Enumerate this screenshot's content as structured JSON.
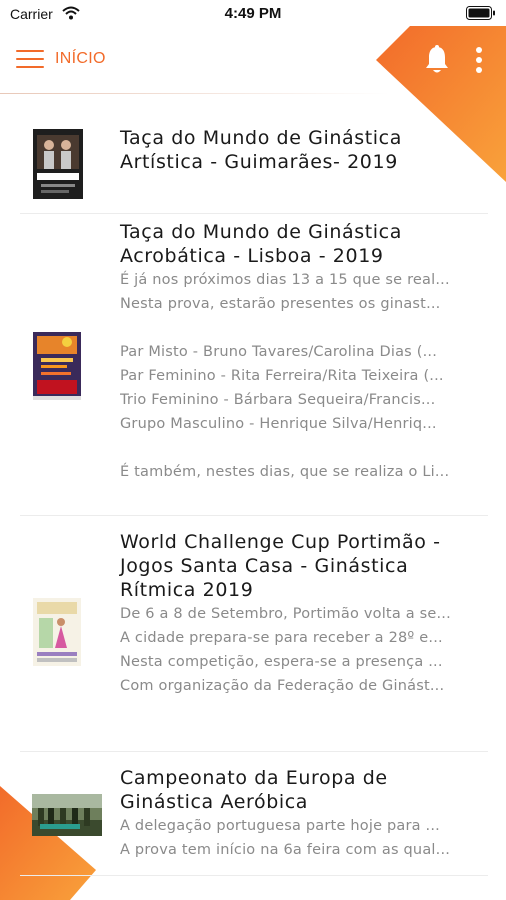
{
  "status_bar": {
    "carrier": "Carrier",
    "time": "4:49 PM"
  },
  "header": {
    "title": "INÍCIO"
  },
  "colors": {
    "accent": "#f26b2a",
    "accent_light": "#f9a23b"
  },
  "icons": {
    "menu": "hamburger-icon",
    "bell": "bell-icon",
    "more": "more-vertical-icon",
    "wifi": "wifi-icon",
    "battery": "battery-icon"
  },
  "news": [
    {
      "title": "Taça do Mundo de Ginástica Artística - Guimarães- 2019",
      "lines": []
    },
    {
      "title": "Taça do Mundo de Ginástica Acrobática - Lisboa - 2019",
      "lines": [
        "É já nos próximos dias 13 a 15 que se real...",
        "Nesta prova, estarão presentes os ginast...",
        "",
        "Par Misto - Bruno Tavares/Carolina Dias (...",
        "Par Feminino - Rita Ferreira/Rita Teixeira (...",
        "Trio Feminino - Bárbara Sequeira/Francis...",
        "Grupo Masculino - Henrique Silva/Henriq...",
        "",
        "É também, nestes dias, que se realiza o Li..."
      ]
    },
    {
      "title": "World Challenge Cup Portimão - Jogos Santa Casa - Ginástica Rítmica 2019",
      "lines": [
        "De 6 a 8 de Setembro, Portimão volta a se...",
        " A cidade prepara-se para receber a 28º e...",
        "Nesta competição, espera-se a presença ...",
        "Com organização da Federação de Ginást..."
      ]
    },
    {
      "title": "Campeonato da Europa de Ginástica Aeróbica",
      "lines": [
        "A delegação portuguesa parte hoje para ...",
        "A prova tem início na 6a feira com as qual..."
      ]
    }
  ]
}
